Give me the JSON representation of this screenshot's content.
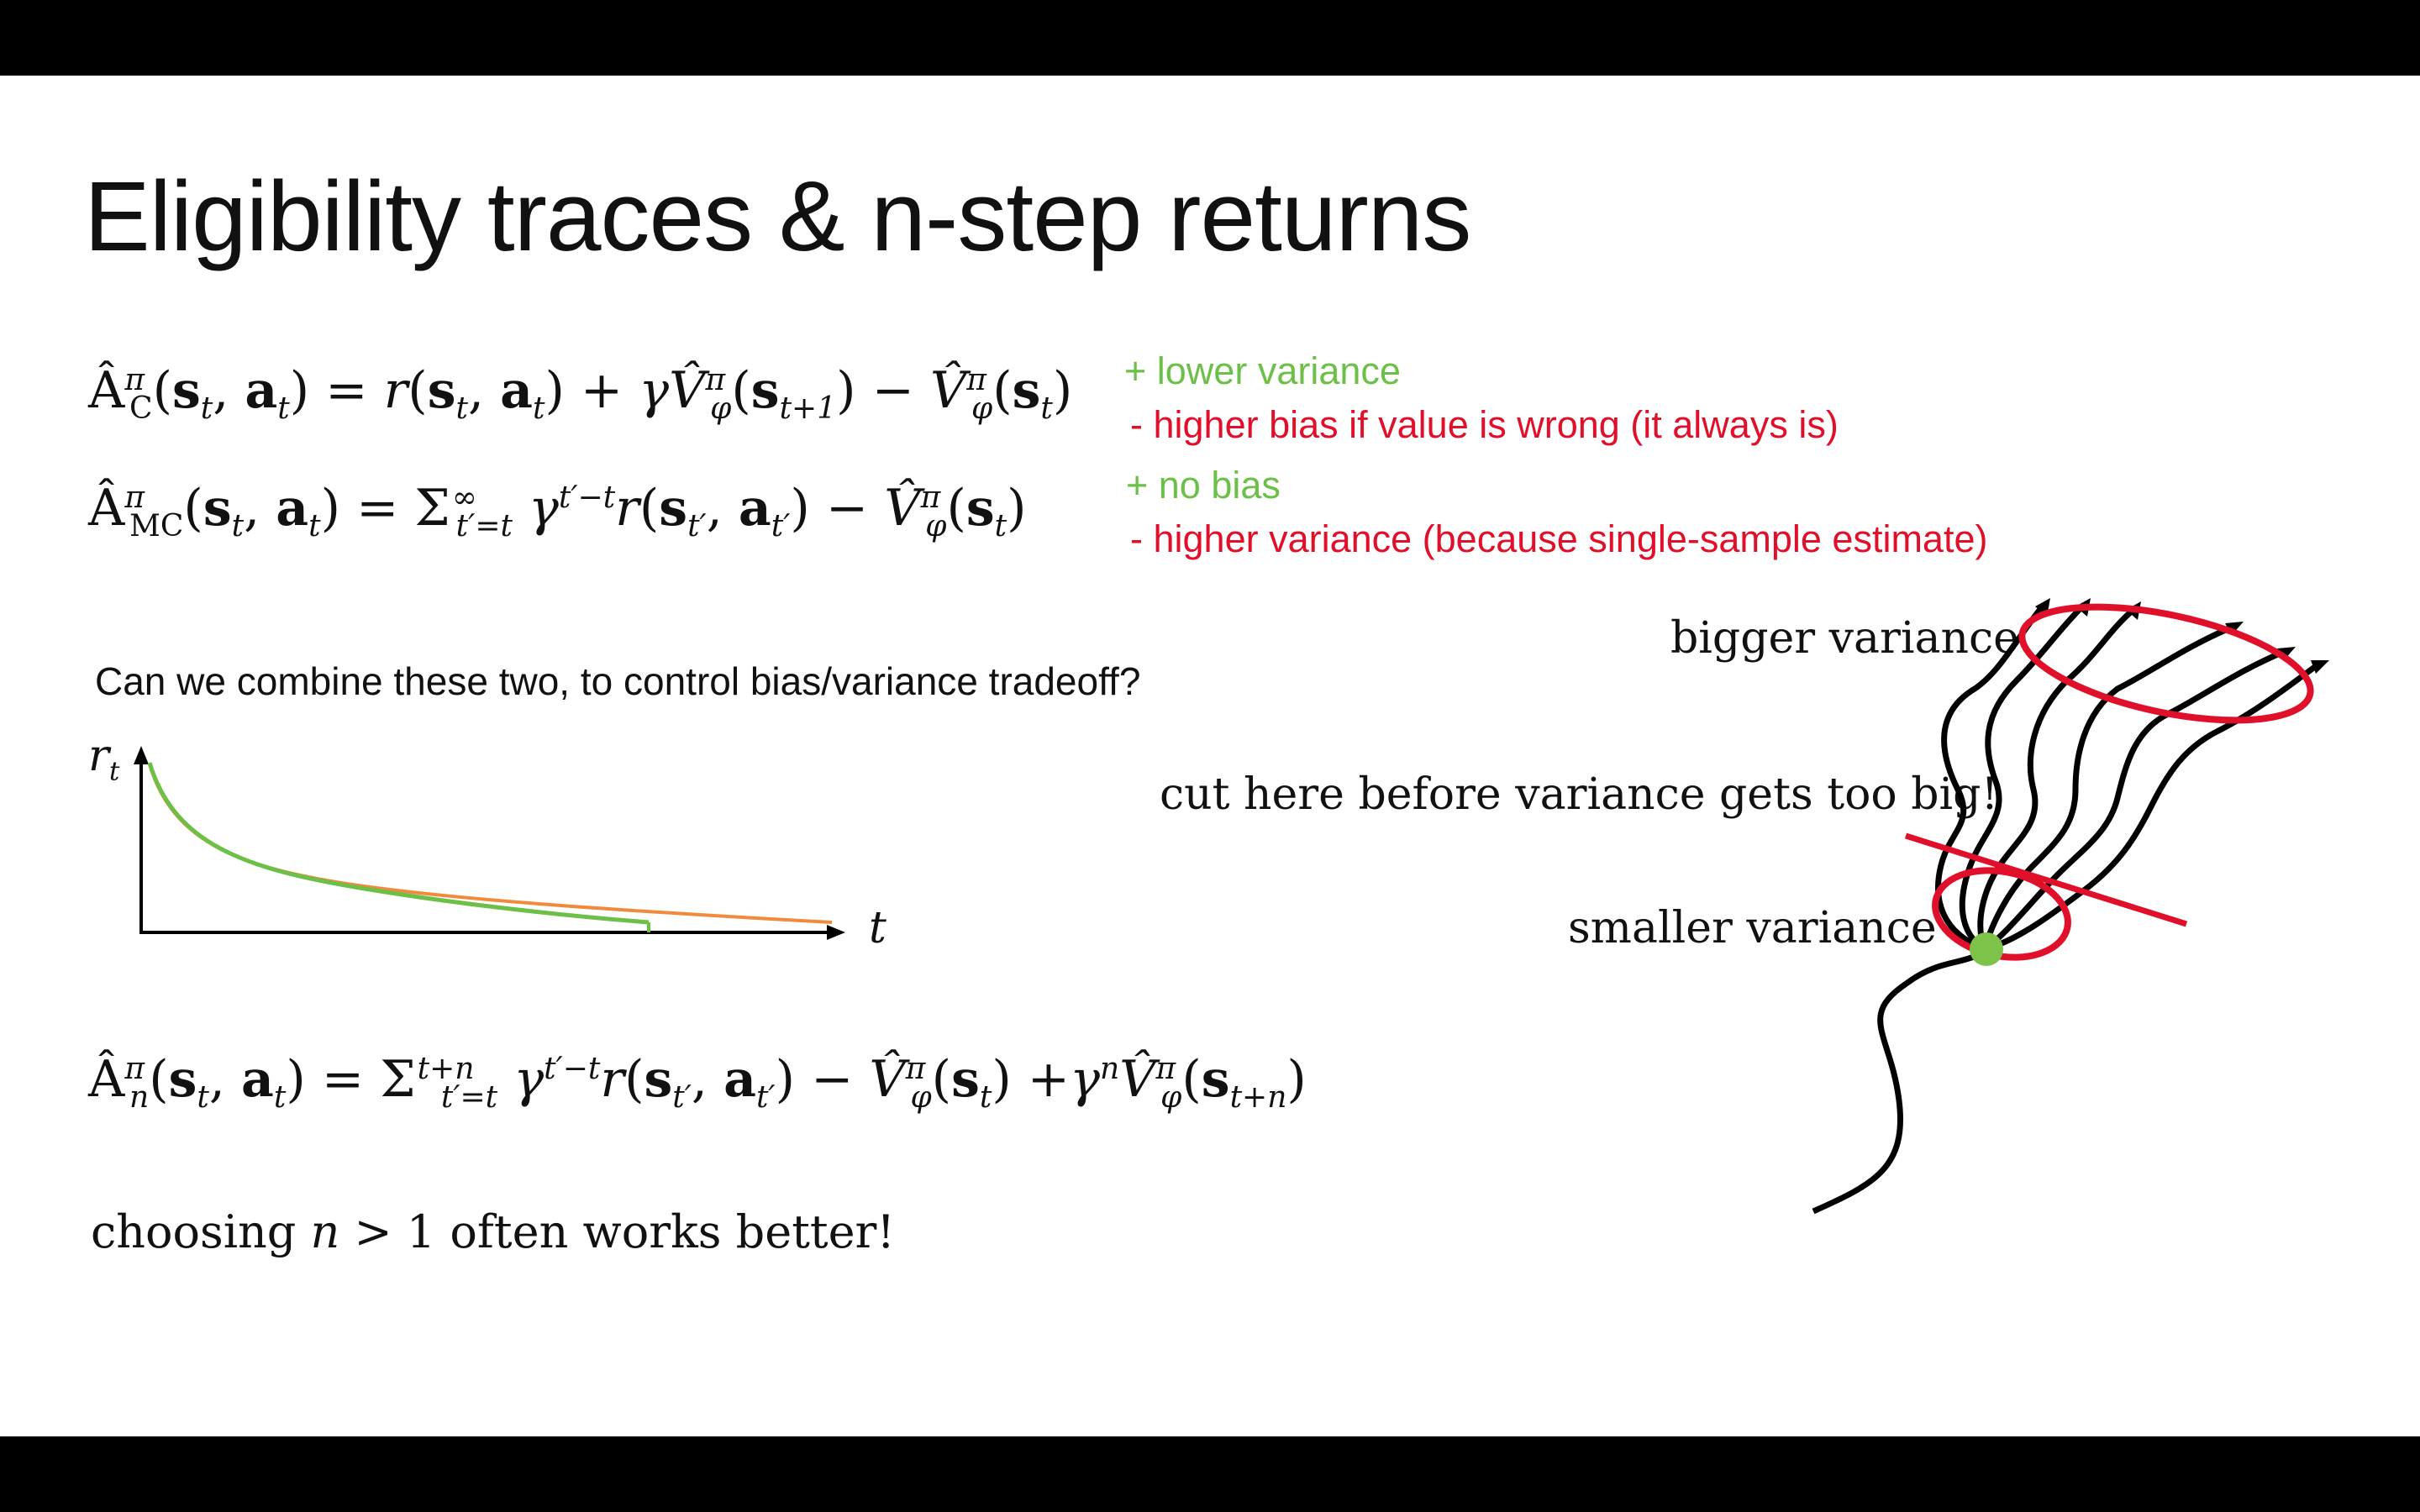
{
  "slide": {
    "title": "Eligibility traces & n-step returns",
    "eq_critic": "Â^π_C(s_t, a_t) = r(s_t, a_t) + γV̂^π_φ(s_{t+1}) − V̂^π_φ(s_t)",
    "eq_mc": "Â^π_MC(s_t, a_t) = Σ_{t′=t}^{∞} γ^{t′−t} r(s_{t′}, a_{t′}) − V̂^π_φ(s_t)",
    "eq_nstep": "Â^π_n(s_t, a_t) = Σ_{t′=t}^{t+n} γ^{t′−t} r(s_{t′}, a_{t′}) − V̂^π_φ(s_t) + γ^n V̂^π_φ(s_{t+n})",
    "critic_pro": "+ lower variance",
    "critic_con": "- higher bias if value is wrong (it always is)",
    "mc_pro": "+ no bias",
    "mc_con": "- higher variance (because single-sample estimate)",
    "question": "Can we combine these two, to control bias/variance tradeoff?",
    "conclusion": "choosing n > 1 often works better!",
    "colors": {
      "pro": "#6cbf47",
      "con": "#e0102a"
    }
  },
  "reward_plot": {
    "y_label": "r_t",
    "x_label": "t"
  },
  "trajectory_diagram": {
    "label_big": "bigger variance",
    "label_cut": "cut here before variance gets too big!",
    "label_small": "smaller variance"
  }
}
